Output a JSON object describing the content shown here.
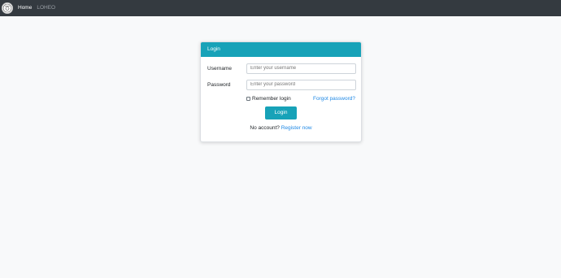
{
  "nav": {
    "logo_icon": "club-logo-icon",
    "home": "Home",
    "brand": "LOHEO"
  },
  "login": {
    "title": "Login",
    "username_label": "Username",
    "username_placeholder": "Enter your username",
    "password_label": "Password",
    "password_placeholder": "Enter your password",
    "remember_label": "Remember login",
    "forgot_link": "Forgot password?",
    "submit": "Login",
    "no_account": "No account?",
    "register_link": "Register now"
  },
  "colors": {
    "accent": "#17a2b8",
    "navbar": "#343a40",
    "link": "#1e88e5"
  }
}
